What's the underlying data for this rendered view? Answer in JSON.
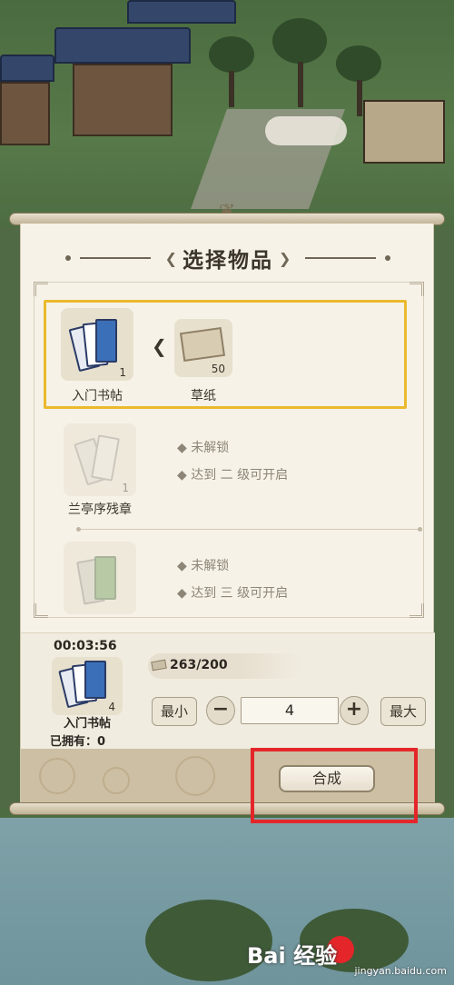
{
  "panel": {
    "title": "选择物品"
  },
  "recipes": [
    {
      "name": "入门书帖",
      "count": "1",
      "selected": true,
      "ingredient": {
        "name": "草纸",
        "count": "50"
      }
    },
    {
      "name": "兰亭序残章",
      "count": "1",
      "locked": true,
      "status": "未解锁",
      "requirement": "达到 二 级可开启"
    },
    {
      "name": "",
      "locked": true,
      "status": "未解锁",
      "requirement": "达到 三 级可开启"
    }
  ],
  "craft": {
    "timer": "00:03:56",
    "item_name": "入门书帖",
    "item_count": "4",
    "owned": "已拥有：0",
    "paper_amount": "263/200",
    "min_label": "最小",
    "max_label": "最大",
    "minus_symbol": "−",
    "plus_symbol": "+",
    "quantity": "4",
    "button_label": "合成"
  },
  "watermark": {
    "text": "Bai 经验",
    "sub": "jingyan.baidu.com"
  },
  "colors": {
    "selection_border": "#eab92d",
    "highlight_box": "#e4262a",
    "panel_bg": "#f6f2e8",
    "footer_bg": "#cdbfa3"
  }
}
